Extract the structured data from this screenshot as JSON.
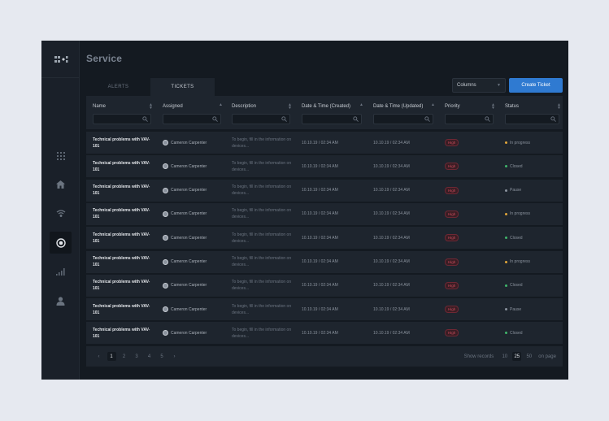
{
  "page": {
    "title": "Service"
  },
  "tabs": [
    {
      "label": "ALERTS",
      "active": false
    },
    {
      "label": "TICKETS",
      "active": true
    }
  ],
  "toolbar": {
    "columns_label": "Columns",
    "create_label": "Create Ticket"
  },
  "table": {
    "columns": [
      "Name",
      "Assigned",
      "Description",
      "Date & Time (Created)",
      "Date & Time (Updated)",
      "Priority",
      "Status"
    ],
    "rows": [
      {
        "name": "Technical problems with VAV-101",
        "assigned": "Cameron Carpenter",
        "desc": "To begin, fill in the information on devices...",
        "created": "10.10.19 / 02:34 AM",
        "updated": "10.10.19 / 02:34 AM",
        "priority": "High",
        "status": "In progress",
        "status_color": "#e0a53a"
      },
      {
        "name": "Technical problems with VAV-101",
        "assigned": "Cameron Carpenter",
        "desc": "To begin, fill in the information on devices...",
        "created": "10.10.19 / 02:34 AM",
        "updated": "10.10.19 / 02:34 AM",
        "priority": "High",
        "status": "Closed",
        "status_color": "#3fb56b"
      },
      {
        "name": "Technical problems with VAV-101",
        "assigned": "Cameron Carpenter",
        "desc": "To begin, fill in the information on devices...",
        "created": "10.10.19 / 02:34 AM",
        "updated": "10.10.19 / 02:34 AM",
        "priority": "High",
        "status": "Pause",
        "status_color": "#8a929d"
      },
      {
        "name": "Technical problems with VAV-101",
        "assigned": "Cameron Carpenter",
        "desc": "To begin, fill in the information on devices...",
        "created": "10.10.19 / 02:34 AM",
        "updated": "10.10.19 / 02:34 AM",
        "priority": "High",
        "status": "In progress",
        "status_color": "#e0a53a"
      },
      {
        "name": "Technical problems with VAV-101",
        "assigned": "Cameron Carpenter",
        "desc": "To begin, fill in the information on devices...",
        "created": "10.10.19 / 02:34 AM",
        "updated": "10.10.19 / 02:34 AM",
        "priority": "High",
        "status": "Closed",
        "status_color": "#3fb56b"
      },
      {
        "name": "Technical problems with VAV-101",
        "assigned": "Cameron Carpenter",
        "desc": "To begin, fill in the information on devices...",
        "created": "10.10.19 / 02:34 AM",
        "updated": "10.10.19 / 02:34 AM",
        "priority": "High",
        "status": "In progress",
        "status_color": "#e0a53a"
      },
      {
        "name": "Technical problems with VAV-101",
        "assigned": "Cameron Carpenter",
        "desc": "To begin, fill in the information on devices...",
        "created": "10.10.19 / 02:34 AM",
        "updated": "10.10.19 / 02:34 AM",
        "priority": "High",
        "status": "Closed",
        "status_color": "#3fb56b"
      },
      {
        "name": "Technical problems with VAV-101",
        "assigned": "Cameron Carpenter",
        "desc": "To begin, fill in the information on devices...",
        "created": "10.10.19 / 02:34 AM",
        "updated": "10.10.19 / 02:34 AM",
        "priority": "High",
        "status": "Pause",
        "status_color": "#8a929d"
      },
      {
        "name": "Technical problems with VAV-101",
        "assigned": "Cameron Carpenter",
        "desc": "To begin, fill in the information on devices...",
        "created": "10.10.19 / 02:34 AM",
        "updated": "10.10.19 / 02:34 AM",
        "priority": "High",
        "status": "Closed",
        "status_color": "#3fb56b"
      }
    ]
  },
  "pagination": {
    "prev": "‹",
    "next": "›",
    "pages": [
      "1",
      "2",
      "3",
      "4",
      "5"
    ],
    "current": "1",
    "show_label": "Show records",
    "sizes": [
      "10",
      "25",
      "50"
    ],
    "selected_size": "25",
    "suffix": "on page"
  },
  "sidebar": {
    "items": [
      "grid-icon",
      "home-icon",
      "wifi-icon",
      "radio-target-icon",
      "signal-bars-icon",
      "user-icon"
    ],
    "active": "radio-target-icon"
  },
  "colors": {
    "accent": "#2f7ad1",
    "background": "#141a21",
    "panel": "#1e252e",
    "danger": "#c94c5c"
  }
}
